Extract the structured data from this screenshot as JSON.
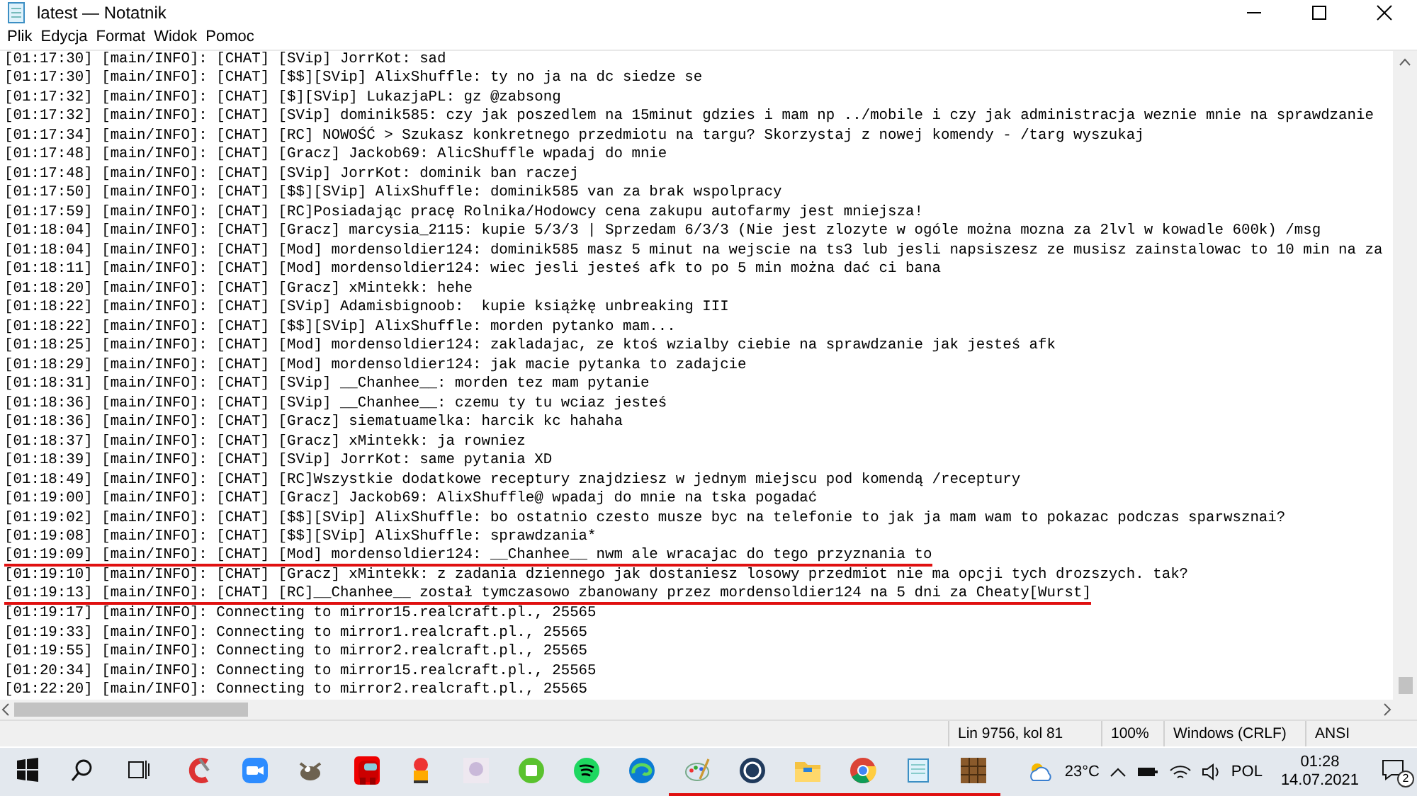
{
  "window": {
    "title": "latest — Notatnik"
  },
  "menu": [
    "Plik",
    "Edycja",
    "Format",
    "Widok",
    "Pomoc"
  ],
  "editor": {
    "lines": [
      {
        "text": "[01:17:30] [main/INFO]: [CHAT] [SVip] JorrKot: sad",
        "underlined": false
      },
      {
        "text": "[01:17:30] [main/INFO]: [CHAT] [$$][SVip] AlixShuffle: ty no ja na dc siedze se",
        "underlined": false
      },
      {
        "text": "[01:17:32] [main/INFO]: [CHAT] [$][SVip] LukazjaPL: gz @zabsong",
        "underlined": false
      },
      {
        "text": "[01:17:32] [main/INFO]: [CHAT] [SVip] dominik585: czy jak poszedlem na 15minut gdzies i mam np ../mobile i czy jak administracja weznie mnie na sprawdzanie",
        "underlined": false
      },
      {
        "text": "[01:17:34] [main/INFO]: [CHAT] [RC] NOWOŚĆ > Szukasz konkretnego przedmiotu na targu? Skorzystaj z nowej komendy - /targ wyszukaj",
        "underlined": false
      },
      {
        "text": "[01:17:48] [main/INFO]: [CHAT] [Gracz] Jackob69: AlicShuffle wpadaj do mnie",
        "underlined": false
      },
      {
        "text": "[01:17:48] [main/INFO]: [CHAT] [SVip] JorrKot: dominik ban raczej",
        "underlined": false
      },
      {
        "text": "[01:17:50] [main/INFO]: [CHAT] [$$][SVip] AlixShuffle: dominik585 van za brak wspolpracy",
        "underlined": false
      },
      {
        "text": "[01:17:59] [main/INFO]: [CHAT] [RC]Posiadając pracę Rolnika/Hodowcy cena zakupu autofarmy jest mniejsza!",
        "underlined": false
      },
      {
        "text": "[01:18:04] [main/INFO]: [CHAT] [Gracz] marcysia_2115: kupie 5/3/3 | Sprzedam 6/3/3 (Nie jest zlozyte w ogóle można mozna za 2lvl w kowadle 600k) /msg",
        "underlined": false
      },
      {
        "text": "[01:18:04] [main/INFO]: [CHAT] [Mod] mordensoldier124: dominik585 masz 5 minut na wejscie na ts3 lub jesli napsiszesz ze musisz zainstalowac to 10 min na za",
        "underlined": false
      },
      {
        "text": "[01:18:11] [main/INFO]: [CHAT] [Mod] mordensoldier124: wiec jesli jesteś afk to po 5 min można dać ci bana",
        "underlined": false
      },
      {
        "text": "[01:18:20] [main/INFO]: [CHAT] [Gracz] xMintekk: hehe",
        "underlined": false
      },
      {
        "text": "[01:18:22] [main/INFO]: [CHAT] [SVip] Adamisbignoob:  kupie książkę unbreaking III",
        "underlined": false
      },
      {
        "text": "[01:18:22] [main/INFO]: [CHAT] [$$][SVip] AlixShuffle: morden pytanko mam...",
        "underlined": false
      },
      {
        "text": "[01:18:25] [main/INFO]: [CHAT] [Mod] mordensoldier124: zakladajac, ze ktoś wzialby ciebie na sprawdzanie jak jesteś afk",
        "underlined": false
      },
      {
        "text": "[01:18:29] [main/INFO]: [CHAT] [Mod] mordensoldier124: jak macie pytanka to zadajcie",
        "underlined": false
      },
      {
        "text": "[01:18:31] [main/INFO]: [CHAT] [SVip] __Chanhee__: morden tez mam pytanie",
        "underlined": false
      },
      {
        "text": "[01:18:36] [main/INFO]: [CHAT] [SVip] __Chanhee__: czemu ty tu wciaz jesteś",
        "underlined": false
      },
      {
        "text": "[01:18:36] [main/INFO]: [CHAT] [Gracz] siematuamelka: harcik kc hahaha",
        "underlined": false
      },
      {
        "text": "[01:18:37] [main/INFO]: [CHAT] [Gracz] xMintekk: ja rowniez",
        "underlined": false
      },
      {
        "text": "[01:18:39] [main/INFO]: [CHAT] [SVip] JorrKot: same pytania XD",
        "underlined": false
      },
      {
        "text": "[01:18:49] [main/INFO]: [CHAT] [RC]Wszystkie dodatkowe receptury znajdziesz w jednym miejscu pod komendą /receptury",
        "underlined": false
      },
      {
        "text": "[01:19:00] [main/INFO]: [CHAT] [Gracz] Jackob69: AlixShuffle@ wpadaj do mnie na tska pogadać",
        "underlined": false
      },
      {
        "text": "[01:19:02] [main/INFO]: [CHAT] [$$][SVip] AlixShuffle: bo ostatnio czesto musze byc na telefonie to jak ja mam wam to pokazac podczas sparwsznai?",
        "underlined": false
      },
      {
        "text": "[01:19:08] [main/INFO]: [CHAT] [$$][SVip] AlixShuffle: sprawdzania*",
        "underlined": false
      },
      {
        "text": "[01:19:09] [main/INFO]: [CHAT] [Mod] mordensoldier124: __Chanhee__ nwm ale wracajac do tego przyznania to",
        "underlined": true
      },
      {
        "text": "[01:19:10] [main/INFO]: [CHAT] [Gracz] xMintekk: z zadania dziennego jak dostaniesz losowy przedmiot nie ma opcji tych drozszych. tak?",
        "underlined": false
      },
      {
        "text": "[01:19:13] [main/INFO]: [CHAT] [RC]__Chanhee__ został tymczasowo zbanowany przez mordensoldier124 na 5 dni za Cheaty[Wurst]",
        "underlined": true
      },
      {
        "text": "[01:19:17] [main/INFO]: Connecting to mirror15.realcraft.pl., 25565",
        "underlined": false
      },
      {
        "text": "[01:19:33] [main/INFO]: Connecting to mirror1.realcraft.pl., 25565",
        "underlined": false
      },
      {
        "text": "[01:19:55] [main/INFO]: Connecting to mirror2.realcraft.pl., 25565",
        "underlined": false
      },
      {
        "text": "[01:20:34] [main/INFO]: Connecting to mirror15.realcraft.pl., 25565",
        "underlined": false
      },
      {
        "text": "[01:22:20] [main/INFO]: Connecting to mirror2.realcraft.pl., 25565",
        "underlined": false
      }
    ]
  },
  "status_bar": {
    "position": "Lin 9756, kol 81",
    "zoom": "100%",
    "line_ending": "Windows (CRLF)",
    "encoding": "ANSI"
  },
  "taskbar": {
    "apps": [
      {
        "kind": "start",
        "running": false
      },
      {
        "kind": "search",
        "running": false
      },
      {
        "kind": "taskview",
        "running": false
      },
      {
        "kind": "cleaner",
        "running": false
      },
      {
        "kind": "camera",
        "running": false
      },
      {
        "kind": "gimp",
        "running": false
      },
      {
        "kind": "crewmate",
        "running": false
      },
      {
        "kind": "figure",
        "running": false
      },
      {
        "kind": "portrait",
        "running": false
      },
      {
        "kind": "greencircle",
        "running": false
      },
      {
        "kind": "spotify",
        "running": false
      },
      {
        "kind": "edge",
        "running": false
      },
      {
        "kind": "palette",
        "running": true
      },
      {
        "kind": "ring",
        "running": true
      },
      {
        "kind": "folder",
        "running": true
      },
      {
        "kind": "chrome",
        "running": true
      },
      {
        "kind": "notepad",
        "running": true
      },
      {
        "kind": "crate",
        "running": true
      }
    ],
    "weather": "23°C",
    "language": "POL",
    "time": "01:28",
    "date": "14.07.2021",
    "notifications": "2"
  }
}
